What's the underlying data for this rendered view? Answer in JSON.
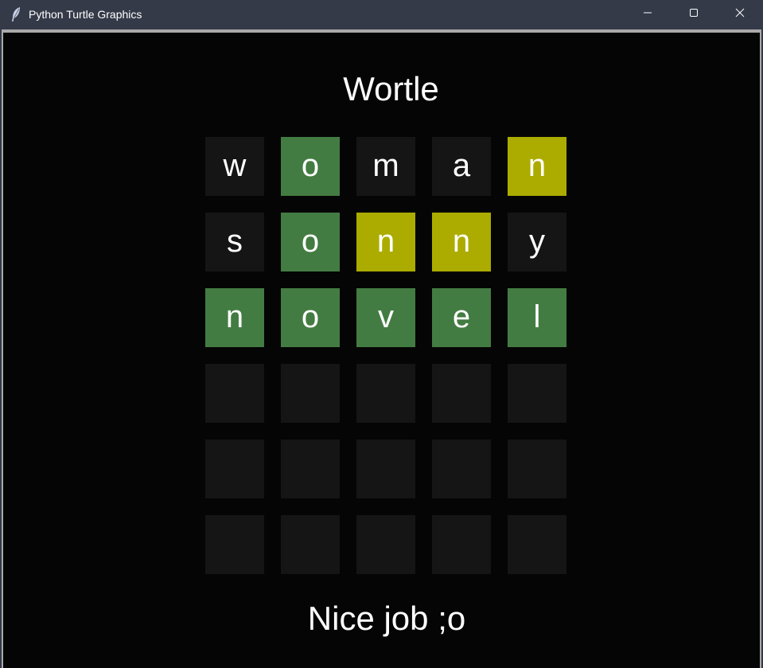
{
  "window": {
    "title": "Python Turtle Graphics",
    "icon": "feather-icon",
    "controls": [
      "minimize-icon",
      "maximize-icon",
      "close-icon"
    ]
  },
  "game": {
    "title": "Wortle",
    "message": "Nice job ;o",
    "colors": {
      "correct": "#437c42",
      "present": "#acac00",
      "empty": "#151515",
      "background": "#050505",
      "text": "#ffffff"
    },
    "rows": [
      [
        {
          "letter": "w",
          "state": "absent"
        },
        {
          "letter": "o",
          "state": "correct"
        },
        {
          "letter": "m",
          "state": "absent"
        },
        {
          "letter": "a",
          "state": "absent"
        },
        {
          "letter": "n",
          "state": "present"
        }
      ],
      [
        {
          "letter": "s",
          "state": "absent"
        },
        {
          "letter": "o",
          "state": "correct"
        },
        {
          "letter": "n",
          "state": "present"
        },
        {
          "letter": "n",
          "state": "present"
        },
        {
          "letter": "y",
          "state": "absent"
        }
      ],
      [
        {
          "letter": "n",
          "state": "correct"
        },
        {
          "letter": "o",
          "state": "correct"
        },
        {
          "letter": "v",
          "state": "correct"
        },
        {
          "letter": "e",
          "state": "correct"
        },
        {
          "letter": "l",
          "state": "correct"
        }
      ],
      [
        {
          "letter": "",
          "state": "empty"
        },
        {
          "letter": "",
          "state": "empty"
        },
        {
          "letter": "",
          "state": "empty"
        },
        {
          "letter": "",
          "state": "empty"
        },
        {
          "letter": "",
          "state": "empty"
        }
      ],
      [
        {
          "letter": "",
          "state": "empty"
        },
        {
          "letter": "",
          "state": "empty"
        },
        {
          "letter": "",
          "state": "empty"
        },
        {
          "letter": "",
          "state": "empty"
        },
        {
          "letter": "",
          "state": "empty"
        }
      ],
      [
        {
          "letter": "",
          "state": "empty"
        },
        {
          "letter": "",
          "state": "empty"
        },
        {
          "letter": "",
          "state": "empty"
        },
        {
          "letter": "",
          "state": "empty"
        },
        {
          "letter": "",
          "state": "empty"
        }
      ]
    ]
  }
}
